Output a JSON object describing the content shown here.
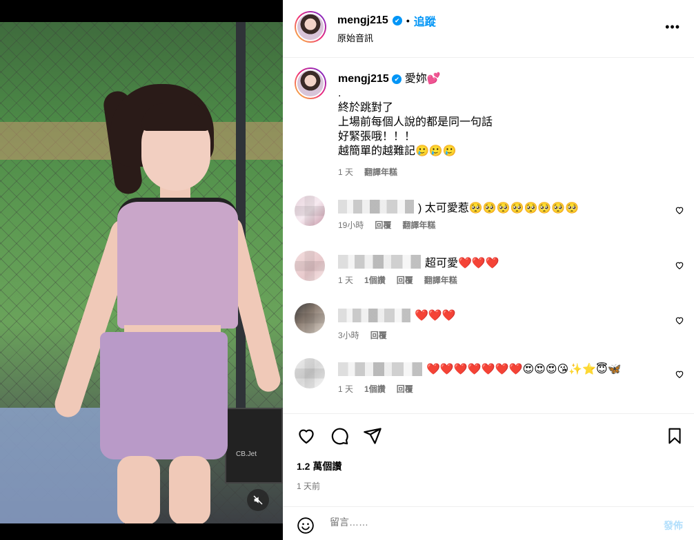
{
  "post": {
    "username": "mengj215",
    "verified_mark": "✔",
    "dot": "•",
    "follow_label": "追蹤",
    "audio_label": "原始音訊",
    "more_label": "•••",
    "mute_icon": "speaker-muted-icon"
  },
  "caption": {
    "username": "mengj215",
    "first_line": "愛妳💕",
    "lines": [
      ".",
      "終於跳對了",
      "上場前每個人說的都是同一句話",
      "好緊張哦！！！",
      "越簡單的越難記🥲🥲🥲"
    ],
    "time": "1 天",
    "translate": "翻譯年糕"
  },
  "comments": [
    {
      "text": ") 太可愛惹🥺🥺🥺🥺🥺🥺🥺🥺",
      "time": "19小時",
      "likes": "",
      "reply": "回覆",
      "translate": "翻譯年糕"
    },
    {
      "text": "超可愛❤️❤️❤️",
      "time": "1 天",
      "likes": "1個讚",
      "reply": "回覆",
      "translate": "翻譯年糕"
    },
    {
      "text": "❤️❤️❤️",
      "time": "3小時",
      "likes": "",
      "reply": "回覆",
      "translate": ""
    },
    {
      "text": "❤️❤️❤️❤️❤️❤️❤️😍😍😍😘✨⭐😇🦋",
      "time": "1 天",
      "likes": "1個讚",
      "reply": "回覆",
      "translate": ""
    }
  ],
  "footer": {
    "likes": "1.2 萬個讚",
    "time": "1 天前",
    "comment_placeholder": "留言……",
    "post_label": "發佈"
  },
  "colors": {
    "accent": "#0095f6",
    "muted": "#737373",
    "heart_red": "#ed1c3b"
  }
}
